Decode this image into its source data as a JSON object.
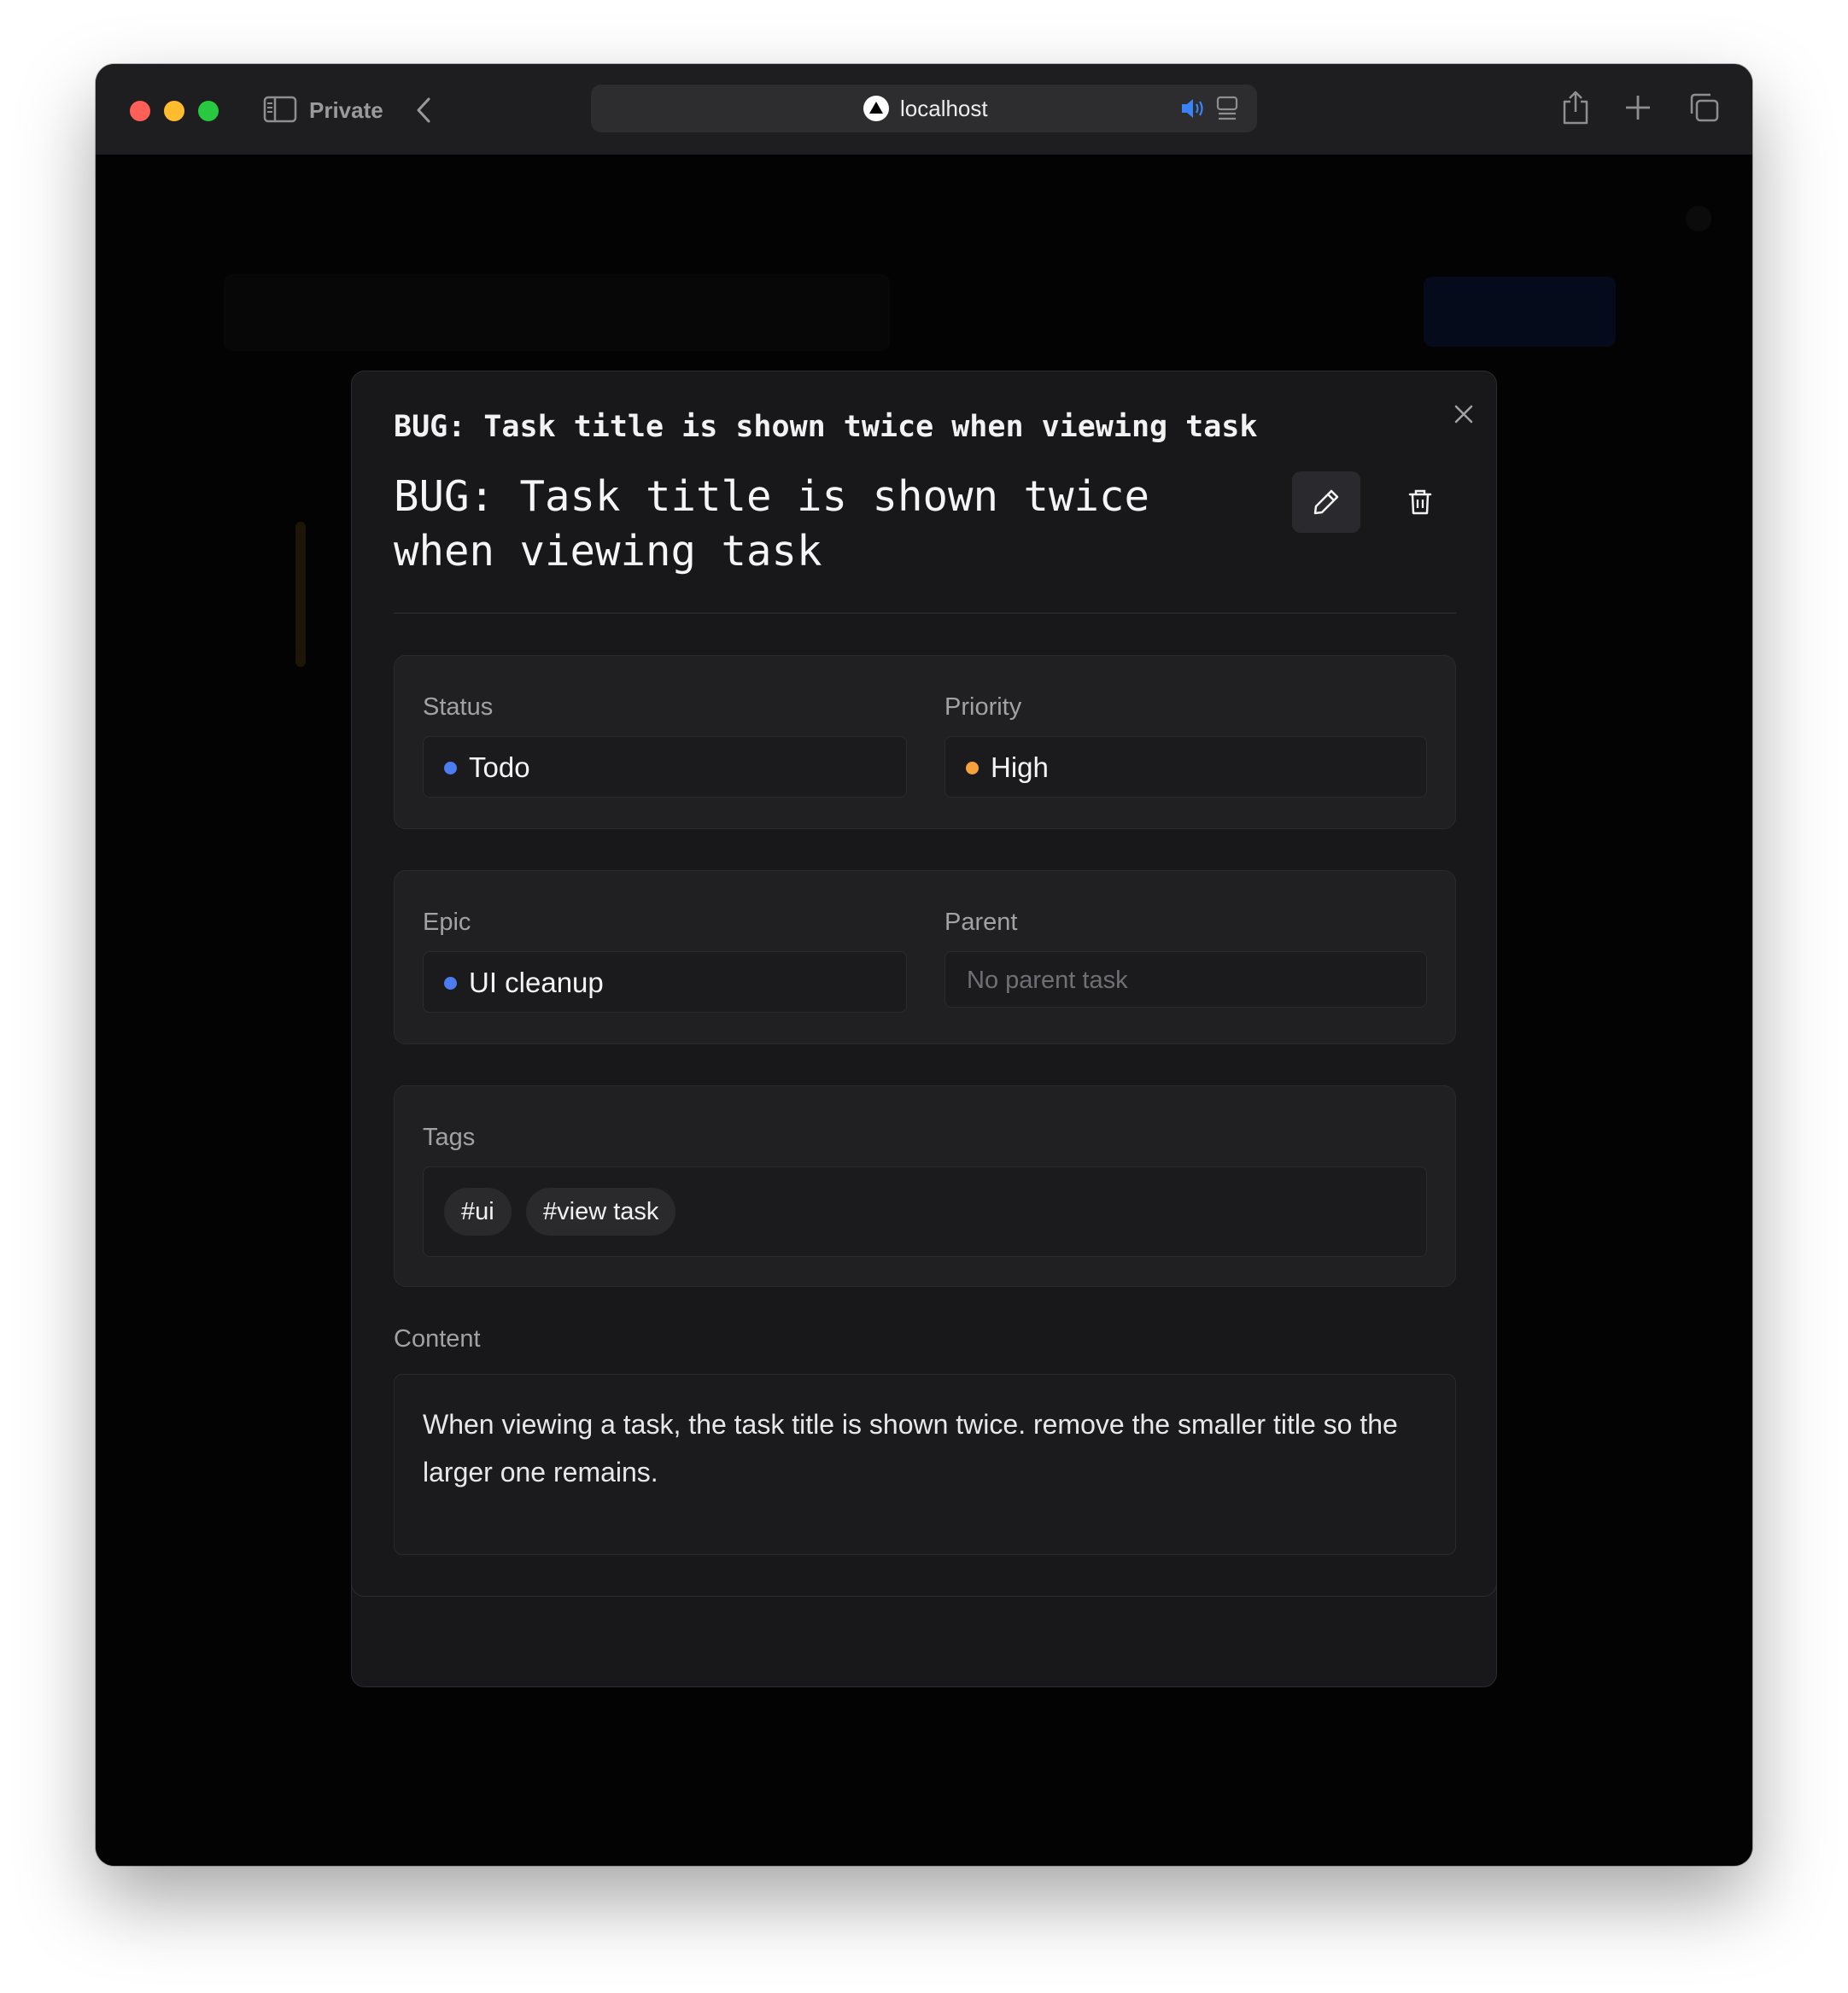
{
  "browser": {
    "private_label": "Private",
    "url": "localhost",
    "icons": [
      "sidebar-icon",
      "chevron-left-icon",
      "site-icon",
      "audio-icon",
      "reader-icon",
      "share-icon",
      "plus-icon",
      "tabs-icon"
    ]
  },
  "modal": {
    "small_title": "BUG: Task title is shown twice when viewing task",
    "big_title": "BUG: Task title is shown twice when viewing task",
    "icons": [
      "close-icon",
      "pencil-icon",
      "trash-icon"
    ],
    "status": {
      "label": "Status",
      "value": "Todo",
      "color": "#4d7cf0"
    },
    "priority": {
      "label": "Priority",
      "value": "High",
      "color": "#f5a23c"
    },
    "epic": {
      "label": "Epic",
      "value": "UI cleanup",
      "color": "#4d7cf0"
    },
    "parent": {
      "label": "Parent",
      "placeholder": "No parent task"
    },
    "tags": {
      "label": "Tags",
      "items": [
        "#ui",
        "#view task"
      ]
    },
    "content": {
      "label": "Content",
      "text": "When viewing a task, the task title is shown twice. remove the smaller title so the larger one remains."
    }
  }
}
